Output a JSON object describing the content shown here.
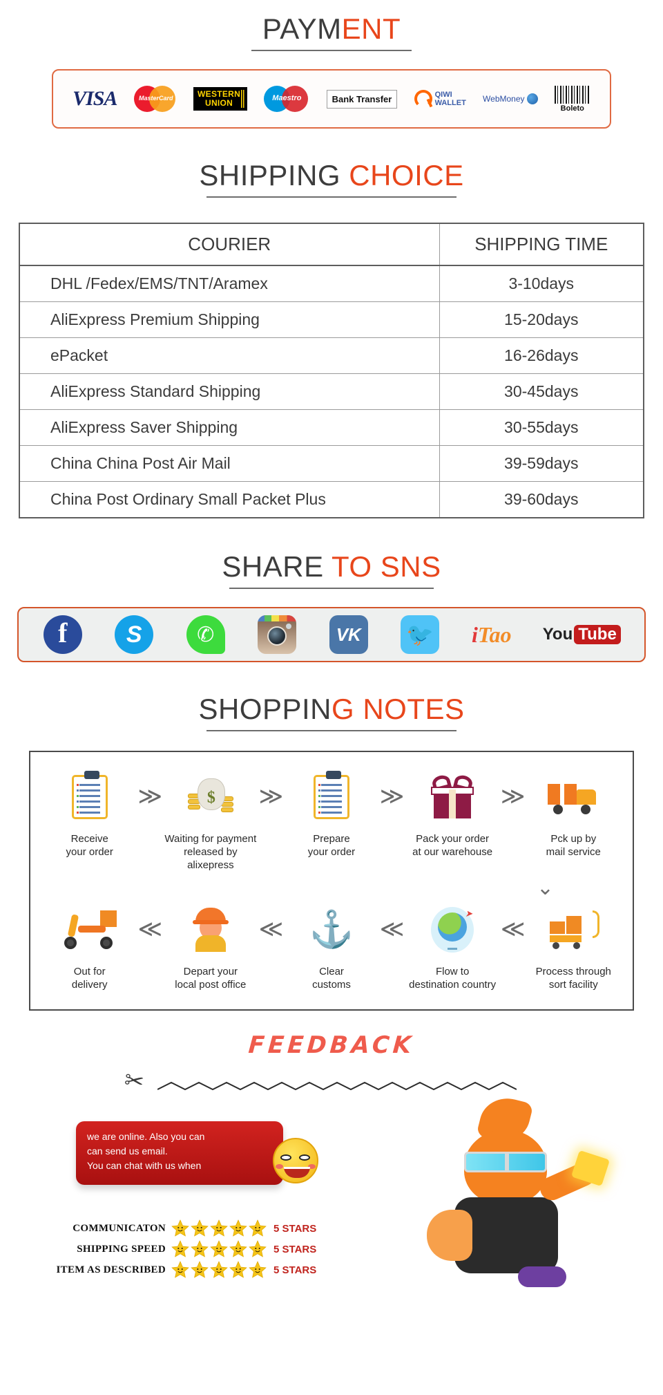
{
  "payment": {
    "heading_dark": "PAYM",
    "heading_accent": "ENT",
    "methods": [
      {
        "name": "visa-logo",
        "label": "VISA"
      },
      {
        "name": "mastercard-logo",
        "label": "MasterCard"
      },
      {
        "name": "western-union-logo",
        "label_line1": "WESTERN",
        "label_line2": "UNION"
      },
      {
        "name": "maestro-logo",
        "label": "Maestro"
      },
      {
        "name": "bank-transfer-logo",
        "label": "Bank Transfer"
      },
      {
        "name": "qiwi-wallet-logo",
        "label_line1": "QIWI",
        "label_line2": "WALLET"
      },
      {
        "name": "webmoney-logo",
        "label": "WebMoney"
      },
      {
        "name": "boleto-logo",
        "label": "Boleto"
      }
    ]
  },
  "shipping": {
    "heading_dark": "SHIPPING",
    "heading_accent": "CHOICE",
    "columns": [
      "COURIER",
      "SHIPPING TIME"
    ],
    "rows": [
      {
        "courier": "DHL /Fedex/EMS/TNT/Aramex",
        "time": "3-10days"
      },
      {
        "courier": "AliExpress Premium Shipping",
        "time": "15-20days"
      },
      {
        "courier": "ePacket",
        "time": "16-26days"
      },
      {
        "courier": "AliExpress Standard Shipping",
        "time": "30-45days"
      },
      {
        "courier": "AliExpress Saver Shipping",
        "time": "30-55days"
      },
      {
        "courier": "China China Post Air Mail",
        "time": "39-59days"
      },
      {
        "courier": "China Post Ordinary Small Packet Plus",
        "time": "39-60days"
      }
    ]
  },
  "sns": {
    "heading_dark": "SHARE",
    "heading_accent": "TO SNS",
    "icons": [
      {
        "name": "facebook-icon",
        "label": "f"
      },
      {
        "name": "skype-icon",
        "label": "S"
      },
      {
        "name": "whatsapp-icon",
        "label": "✆"
      },
      {
        "name": "instagram-icon",
        "label": "Instagram"
      },
      {
        "name": "vk-icon",
        "label": "VK"
      },
      {
        "name": "twitter-icon",
        "label": "🐦"
      },
      {
        "name": "itao-icon",
        "label_i": "i",
        "label_t": "T",
        "label_ao": "ao"
      },
      {
        "name": "youtube-icon",
        "label_you": "You",
        "label_tube": "Tube"
      }
    ]
  },
  "notes": {
    "heading_dark": "SHOPPIN",
    "heading_accent": "G NOTES",
    "row1": [
      {
        "icon": "clipboard-icon",
        "label": "Receive\nyour order"
      },
      {
        "icon": "money-bag-icon",
        "label": "Waiting for payment\nreleased by alixepress"
      },
      {
        "icon": "clipboard-icon",
        "label": "Prepare\nyour order"
      },
      {
        "icon": "gift-box-icon",
        "label": "Pack your order\nat our warehouse"
      },
      {
        "icon": "delivery-truck-icon",
        "label": "Pck up by\nmail service"
      }
    ],
    "row2": [
      {
        "icon": "scooter-icon",
        "label": "Out for\ndelivery"
      },
      {
        "icon": "postman-icon",
        "label": "Depart your\nlocal post office"
      },
      {
        "icon": "anchor-icon",
        "label": "Clear\ncustoms"
      },
      {
        "icon": "globe-icon",
        "label": "Flow to\ndestination country"
      },
      {
        "icon": "sorting-cart-icon",
        "label": "Process through\nsort facility"
      }
    ],
    "arrow_right": "≫",
    "arrow_left": "≪",
    "arrow_down": "⌄"
  },
  "feedback": {
    "title": "FEEDBACK",
    "chat_lines": [
      "we are online. Also you can",
      "can send us email.",
      "You can chat with us when"
    ],
    "ratings": [
      {
        "label": "COMMUNICATON",
        "stars": 5,
        "value": "5 STARS"
      },
      {
        "label": "SHIPPING SPEED",
        "stars": 5,
        "value": "5 STARS"
      },
      {
        "label": "ITEM AS DESCRIBED",
        "stars": 5,
        "value": "5 STARS"
      }
    ]
  },
  "colors": {
    "accent": "#e8461b",
    "border_orange": "#e06a42",
    "table_border": "#5d5d5d",
    "feedback_red": "#ef5b4c",
    "star_gold": "#f5c518"
  }
}
